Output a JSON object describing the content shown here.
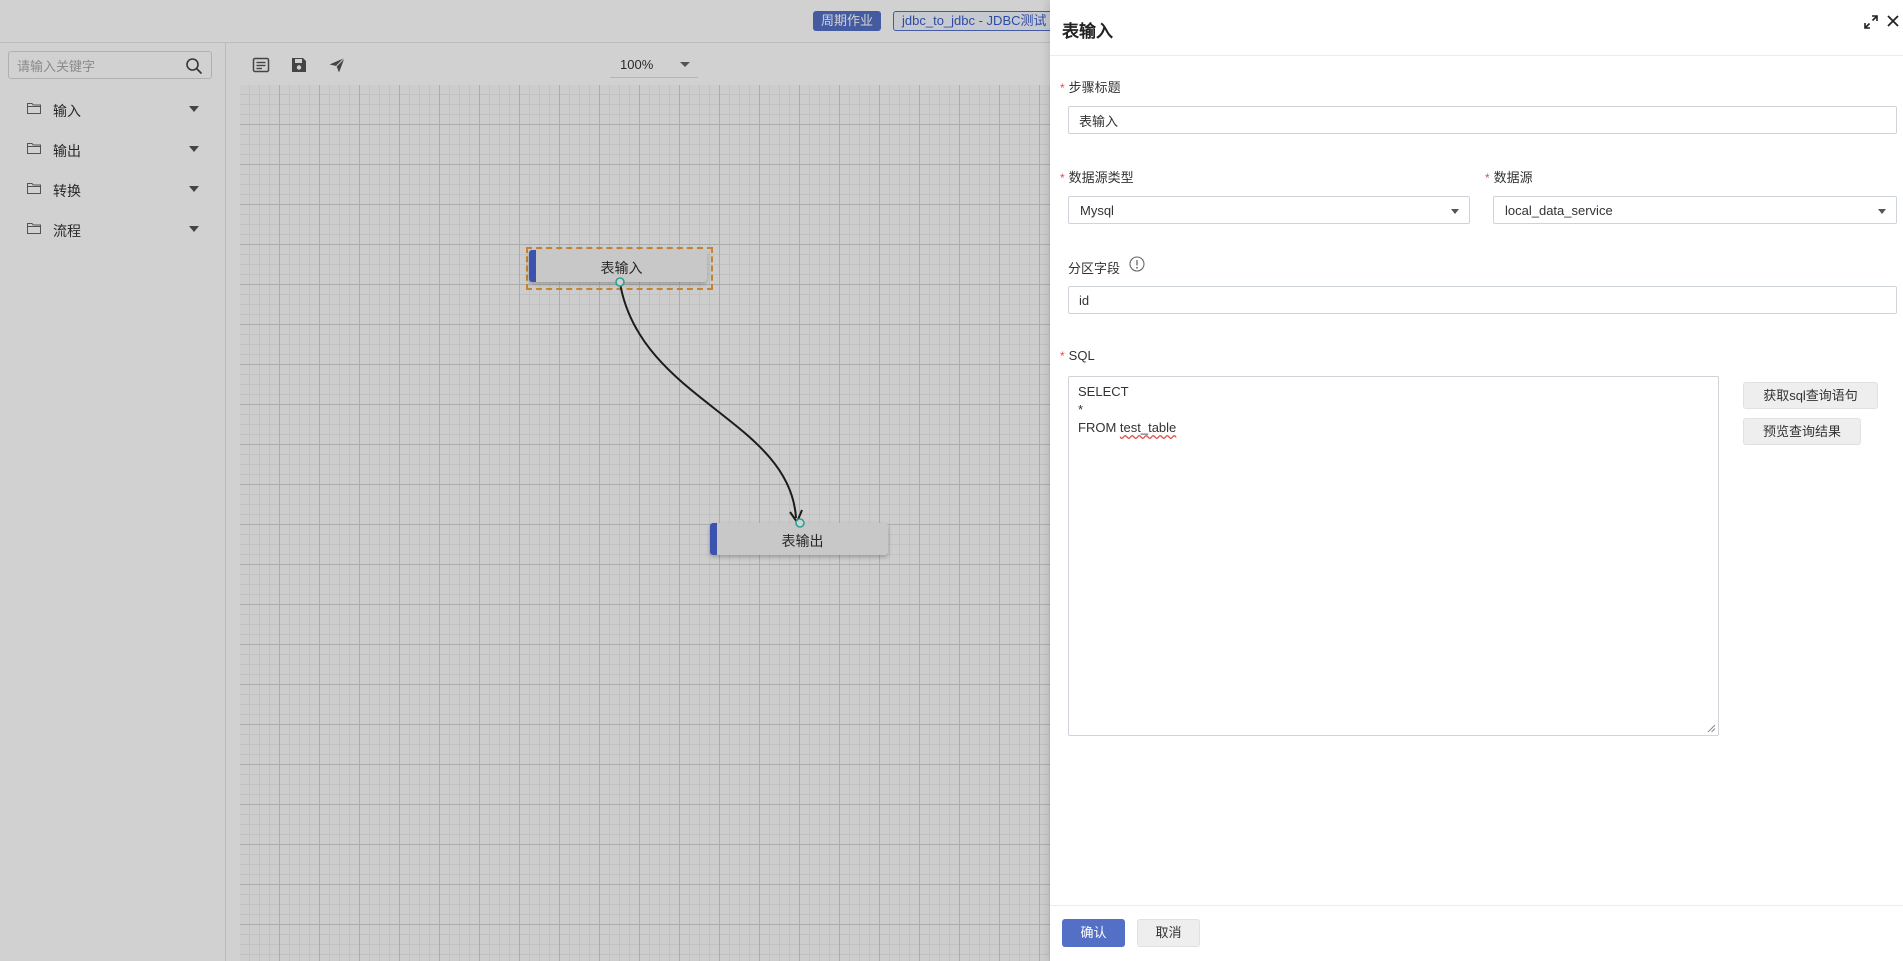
{
  "topbar": {
    "tag_periodic": "周期作业",
    "tag_job": "jdbc_to_jdbc - JDBC测试"
  },
  "sidebar": {
    "search_placeholder": "请输入关键字",
    "items": [
      {
        "label": "输入"
      },
      {
        "label": "输出"
      },
      {
        "label": "转换"
      },
      {
        "label": "流程"
      }
    ]
  },
  "toolbar": {
    "zoom": "100%"
  },
  "canvas": {
    "nodes": [
      {
        "label": "表输入"
      },
      {
        "label": "表输出"
      }
    ]
  },
  "drawer": {
    "title": "表输入",
    "step_title_label": "步骤标题",
    "step_title_value": "表输入",
    "ds_type_label": "数据源类型",
    "ds_type_value": "Mysql",
    "ds_label": "数据源",
    "ds_value": "local_data_service",
    "partition_label": "分区字段",
    "partition_value": "id",
    "sql_label": "SQL",
    "sql_lines": [
      "SELECT",
      "*",
      "FROM"
    ],
    "sql_table": "test_table",
    "get_sql_button": "获取sql查询语句",
    "preview_button": "预览查询结果",
    "confirm": "确认",
    "cancel": "取消"
  },
  "colors": {
    "accent": "#5470c6",
    "node_bar": "#4a64d6",
    "selection": "#f0a23b",
    "required": "#e34d4d",
    "port": "#34c5b5"
  }
}
